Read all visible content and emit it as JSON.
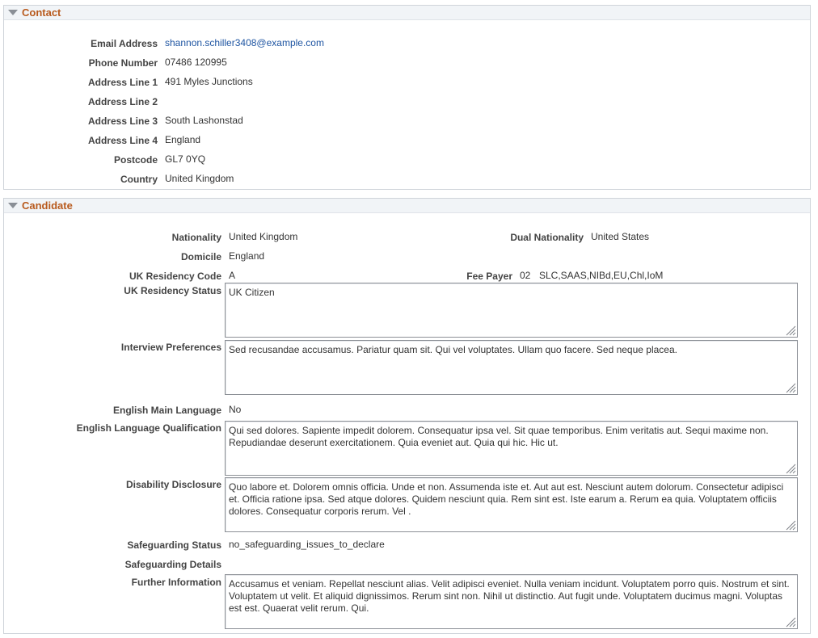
{
  "contact": {
    "title": "Contact",
    "fields": {
      "email": {
        "label": "Email Address",
        "value": "shannon.schiller3408@example.com"
      },
      "phone": {
        "label": "Phone Number",
        "value": "07486 120995"
      },
      "address1": {
        "label": "Address Line 1",
        "value": "491 Myles Junctions"
      },
      "address2": {
        "label": "Address Line 2",
        "value": ""
      },
      "address3": {
        "label": "Address Line 3",
        "value": "South Lashonstad"
      },
      "address4": {
        "label": "Address Line 4",
        "value": "England"
      },
      "postcode": {
        "label": "Postcode",
        "value": "GL7 0YQ"
      },
      "country": {
        "label": "Country",
        "value": "United Kingdom"
      }
    }
  },
  "candidate": {
    "title": "Candidate",
    "nationality": {
      "label": "Nationality",
      "value": "United Kingdom"
    },
    "dual_nationality": {
      "label": "Dual Nationality",
      "value": "United States"
    },
    "domicile": {
      "label": "Domicile",
      "value": "England"
    },
    "uk_residency_code": {
      "label": "UK Residency Code",
      "value": "A"
    },
    "fee_payer": {
      "label": "Fee Payer",
      "code": "02",
      "value": "SLC,SAAS,NIBd,EU,Chl,IoM"
    },
    "uk_residency_status": {
      "label": "UK Residency Status",
      "value": "UK Citizen"
    },
    "interview_preferences": {
      "label": "Interview Preferences",
      "value": "Sed recusandae accusamus. Pariatur quam sit. Qui vel voluptates. Ullam quo facere. Sed neque placea."
    },
    "english_main_language": {
      "label": "English Main Language",
      "value": "No"
    },
    "english_language_qualification": {
      "label": "English Language Qualification",
      "value": "Qui sed dolores. Sapiente impedit dolorem. Consequatur ipsa vel. Sit quae temporibus. Enim veritatis aut. Sequi maxime non. Repudiandae deserunt exercitationem. Quia eveniet aut. Quia qui hic. Hic ut."
    },
    "disability_disclosure": {
      "label": "Disability Disclosure",
      "value": "Quo labore et. Dolorem omnis officia. Unde et non. Assumenda iste et. Aut aut est. Nesciunt autem dolorum. Consectetur adipisci et. Officia ratione ipsa. Sed atque dolores. Quidem nesciunt quia. Rem sint est. Iste earum a. Rerum ea quia. Voluptatem officiis dolores. Consequatur corporis rerum. Vel ."
    },
    "safeguarding_status": {
      "label": "Safeguarding Status",
      "value": "no_safeguarding_issues_to_declare"
    },
    "safeguarding_details": {
      "label": "Safeguarding Details",
      "value": ""
    },
    "further_information": {
      "label": "Further Information",
      "value": "Accusamus et veniam. Repellat nesciunt alias. Velit adipisci eveniet. Nulla veniam incidunt. Voluptatem porro quis. Nostrum et sint. Voluptatem ut velit. Et aliquid dignissimos. Rerum sint non. Nihil ut distinctio. Aut fugit unde. Voluptatem ducimus magni. Voluptas est est. Quaerat velit rerum. Qui."
    }
  },
  "colors": {
    "section_title": "#b85a1d",
    "link": "#1f55a2",
    "header_bg": "#f1f4f7",
    "border": "#cfd4da"
  },
  "icons": {
    "collapse": "triangle-down-icon",
    "resize": "resize-grip-icon"
  }
}
